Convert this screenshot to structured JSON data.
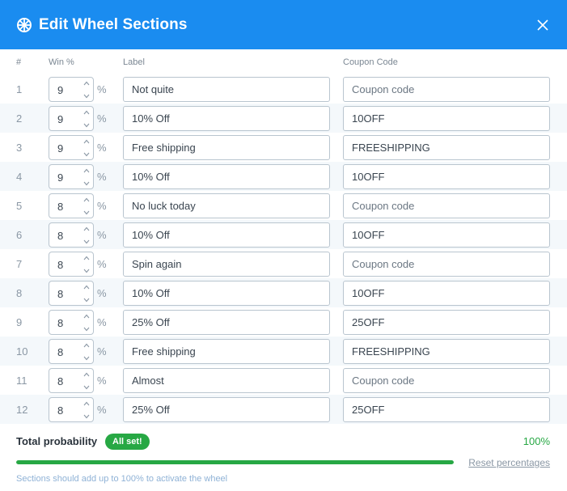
{
  "header": {
    "title": "Edit Wheel Sections"
  },
  "columns": {
    "num": "#",
    "win": "Win %",
    "label": "Label",
    "coupon": "Coupon Code"
  },
  "percent_symbol": "%",
  "coupon_placeholder": "Coupon code",
  "rows": [
    {
      "num": "1",
      "win": "9",
      "label": "Not quite",
      "coupon": ""
    },
    {
      "num": "2",
      "win": "9",
      "label": "10% Off",
      "coupon": "10OFF"
    },
    {
      "num": "3",
      "win": "9",
      "label": "Free shipping",
      "coupon": "FREESHIPPING"
    },
    {
      "num": "4",
      "win": "9",
      "label": "10% Off",
      "coupon": "10OFF"
    },
    {
      "num": "5",
      "win": "8",
      "label": "No luck today",
      "coupon": ""
    },
    {
      "num": "6",
      "win": "8",
      "label": "10% Off",
      "coupon": "10OFF"
    },
    {
      "num": "7",
      "win": "8",
      "label": "Spin again",
      "coupon": ""
    },
    {
      "num": "8",
      "win": "8",
      "label": "10% Off",
      "coupon": "10OFF"
    },
    {
      "num": "9",
      "win": "8",
      "label": "25% Off",
      "coupon": "25OFF"
    },
    {
      "num": "10",
      "win": "8",
      "label": "Free shipping",
      "coupon": "FREESHIPPING"
    },
    {
      "num": "11",
      "win": "8",
      "label": "Almost",
      "coupon": ""
    },
    {
      "num": "12",
      "win": "8",
      "label": "25% Off",
      "coupon": "25OFF"
    }
  ],
  "footer": {
    "total_label": "Total probability",
    "badge": "All set!",
    "percent": "100%",
    "progress_fraction": 1.0,
    "reset_label": "Reset percentages",
    "hint": "Sections should add up to 100% to activate the wheel"
  },
  "colors": {
    "header_bg": "#1a8cf0",
    "success": "#27a844",
    "row_alt": "#f4f8fb"
  },
  "icons": {
    "header": "wheel-icon",
    "close": "close-icon",
    "stepper": "chevron-up-down-icon"
  }
}
